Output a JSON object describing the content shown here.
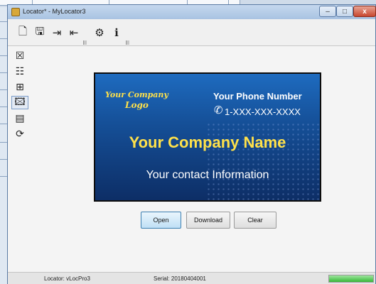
{
  "window": {
    "title": "Locator* - MyLocator3",
    "controls": {
      "minimize": "–",
      "maximize": "□",
      "close": "x"
    }
  },
  "toolbar": {
    "icons": [
      "new-document-icon",
      "save-icon",
      "export-icon",
      "import-icon",
      "settings-form-icon",
      "info-icon"
    ],
    "glyphs": {
      "new": "🗋",
      "save": "🖫",
      "export": "⇥",
      "import": "⇤",
      "settings": "⚙",
      "info": "ℹ"
    }
  },
  "sidebar": {
    "items": [
      {
        "name": "contact-card-icon",
        "glyph": "☒"
      },
      {
        "name": "list-icon",
        "glyph": "☷"
      },
      {
        "name": "grid-icon",
        "glyph": "⊞"
      },
      {
        "name": "image-icon",
        "glyph": "🖾",
        "active": true
      },
      {
        "name": "phone-icon",
        "glyph": "▤"
      },
      {
        "name": "refresh-icon",
        "glyph": "⟳"
      }
    ]
  },
  "card": {
    "logo_line1": "Your Company",
    "logo_line2": "Logo",
    "phone_label": "Your Phone Number",
    "phone_number": "1-XXX-XXX-XXXX",
    "company_name": "Your Company Name",
    "contact": "Your contact Information",
    "colors": {
      "accent": "#ffe14a",
      "background": "#154f97"
    }
  },
  "actions": {
    "open": "Open",
    "download": "Download",
    "clear": "Clear"
  },
  "status": {
    "locator": "Locator: vLocPro3",
    "serial": "Serial: 20180404001",
    "progress": 1.0
  }
}
